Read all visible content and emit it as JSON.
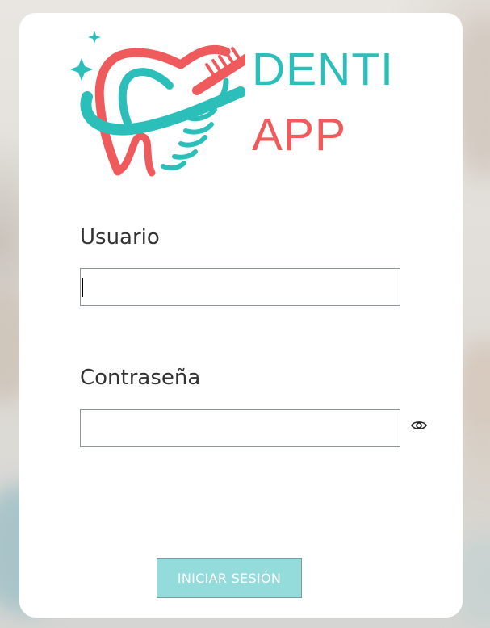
{
  "brand": {
    "line1": "DENTI",
    "line2": "APP",
    "colors": {
      "teal": "#2cbfb9",
      "coral": "#ef5a5c"
    },
    "logo_icon": "tooth-toothbrush-icon"
  },
  "form": {
    "user_label": "Usuario",
    "user_value": "",
    "password_label": "Contraseña",
    "password_value": "",
    "password_toggle_icon": "eye-icon",
    "submit_label": "INICIAR SESIÓN",
    "submit_color": "#93dcdb"
  }
}
